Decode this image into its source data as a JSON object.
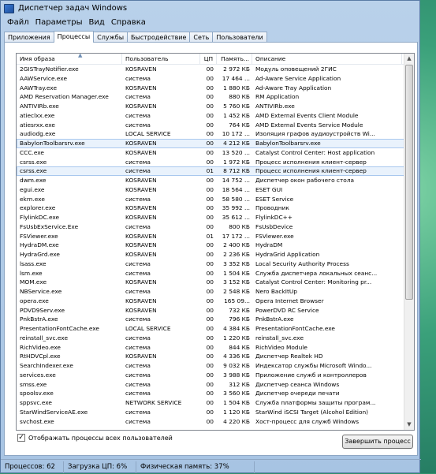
{
  "window": {
    "title": "Диспетчер задач Windows"
  },
  "menu": [
    "Файл",
    "Параметры",
    "Вид",
    "Справка"
  ],
  "tabs": [
    "Приложения",
    "Процессы",
    "Службы",
    "Быстродействие",
    "Сеть",
    "Пользователи"
  ],
  "active_tab": "Процессы",
  "columns": [
    "Имя образа",
    "Пользователь",
    "ЦП",
    "Память...",
    "Описание"
  ],
  "processes": [
    [
      "2GISTrayNotifier.exe",
      "KOSRAVEN",
      "00",
      "2 972 КБ",
      "Модуль оповещений 2ГИС"
    ],
    [
      "AAWService.exe",
      "система",
      "00",
      "17 464 ...",
      "Ad-Aware Service Application"
    ],
    [
      "AAWTray.exe",
      "KOSRAVEN",
      "00",
      "1 880 КБ",
      "Ad-Aware Tray Application"
    ],
    [
      "AMD Reservation Manager.exe",
      "система",
      "00",
      "880 КБ",
      "RM Application"
    ],
    [
      "ANTIVIRb.exe",
      "KOSRAVEN",
      "00",
      "5 760 КБ",
      "ANTIVIRb.exe"
    ],
    [
      "atieclxx.exe",
      "система",
      "00",
      "1 452 КБ",
      "AMD External Events Client Module"
    ],
    [
      "atiesrxx.exe",
      "система",
      "00",
      "764 КБ",
      "AMD External Events Service Module"
    ],
    [
      "audiodg.exe",
      "LOCAL SERVICE",
      "00",
      "10 172 ...",
      "Изоляция графов аудиоустройств Wi..."
    ],
    [
      "BabylonToolbarsrv.exe",
      "KOSRAVEN",
      "00",
      "4 212 КБ",
      "BabylonToolbarsrv.exe"
    ],
    [
      "CCC.exe",
      "KOSRAVEN",
      "00",
      "13 520 ...",
      "Catalyst Control Center: Host application"
    ],
    [
      "csrss.exe",
      "система",
      "00",
      "1 972 КБ",
      "Процесс исполнения клиент-сервер"
    ],
    [
      "csrss.exe",
      "система",
      "01",
      "8 712 КБ",
      "Процесс исполнения клиент-сервер"
    ],
    [
      "dwm.exe",
      "KOSRAVEN",
      "00",
      "14 752 ...",
      "Диспетчер окон рабочего стола"
    ],
    [
      "egui.exe",
      "KOSRAVEN",
      "00",
      "18 564 ...",
      "ESET GUI"
    ],
    [
      "ekrn.exe",
      "система",
      "00",
      "58 580 ...",
      "ESET Service"
    ],
    [
      "explorer.exe",
      "KOSRAVEN",
      "00",
      "35 992 ...",
      "Проводник"
    ],
    [
      "FlylinkDC.exe",
      "KOSRAVEN",
      "00",
      "35 612 ...",
      "FlylinkDC++"
    ],
    [
      "FsUsbExService.Exe",
      "система",
      "00",
      "800 КБ",
      "FsUsbDevice"
    ],
    [
      "FSViewer.exe",
      "KOSRAVEN",
      "01",
      "17 172 ...",
      "FSViewer.exe"
    ],
    [
      "HydraDM.exe",
      "KOSRAVEN",
      "00",
      "2 400 КБ",
      "HydraDM"
    ],
    [
      "HydraGrd.exe",
      "KOSRAVEN",
      "00",
      "2 236 КБ",
      "HydraGrid Application"
    ],
    [
      "lsass.exe",
      "система",
      "00",
      "3 352 КБ",
      "Local Security Authority Process"
    ],
    [
      "lsm.exe",
      "система",
      "00",
      "1 504 КБ",
      "Служба диспетчера локальных сеанс..."
    ],
    [
      "MOM.exe",
      "KOSRAVEN",
      "00",
      "3 152 КБ",
      "Catalyst Control Center: Monitoring pr..."
    ],
    [
      "NBService.exe",
      "система",
      "00",
      "2 548 КБ",
      "Nero BackItUp"
    ],
    [
      "opera.exe",
      "KOSRAVEN",
      "00",
      "165 09...",
      "Opera Internet Browser"
    ],
    [
      "PDVD9Serv.exe",
      "KOSRAVEN",
      "00",
      "732 КБ",
      "PowerDVD RC Service"
    ],
    [
      "PnkBstrA.exe",
      "система",
      "00",
      "796 КБ",
      "PnkBstrA.exe"
    ],
    [
      "PresentationFontCache.exe",
      "LOCAL SERVICE",
      "00",
      "4 384 КБ",
      "PresentationFontCache.exe"
    ],
    [
      "reinstall_svc.exe",
      "система",
      "00",
      "1 220 КБ",
      "reinstall_svc.exe"
    ],
    [
      "RichVideo.exe",
      "система",
      "00",
      "844 КБ",
      "RichVideo Module"
    ],
    [
      "RtHDVCpl.exe",
      "KOSRAVEN",
      "00",
      "4 336 КБ",
      "Диспетчер Realtek HD"
    ],
    [
      "SearchIndexer.exe",
      "система",
      "00",
      "9 032 КБ",
      "Индексатор службы Microsoft Windo..."
    ],
    [
      "services.exe",
      "система",
      "00",
      "3 988 КБ",
      "Приложение служб и контроллеров"
    ],
    [
      "smss.exe",
      "система",
      "00",
      "312 КБ",
      "Диспетчер сеанса  Windows"
    ],
    [
      "spoolsv.exe",
      "система",
      "00",
      "3 560 КБ",
      "Диспетчер очереди печати"
    ],
    [
      "sppsvc.exe",
      "NETWORK SERVICE",
      "00",
      "1 504 КБ",
      "Служба платформы защиты програм..."
    ],
    [
      "StarWindServiceAE.exe",
      "система",
      "00",
      "1 120 КБ",
      "StarWind iSCSI Target (Alcohol Edition)"
    ],
    [
      "svchost.exe",
      "система",
      "00",
      "4 220 КБ",
      "Хост-процесс для служб Windows"
    ]
  ],
  "selected_index": 8,
  "show_all_label": "Отображать процессы всех пользователей",
  "show_all_checked": true,
  "end_process_label": "Завершить процесс",
  "status": {
    "processes": "Процессов: 62",
    "cpu": "Загрузка ЦП: 6%",
    "memory": "Физическая память: 37%"
  }
}
